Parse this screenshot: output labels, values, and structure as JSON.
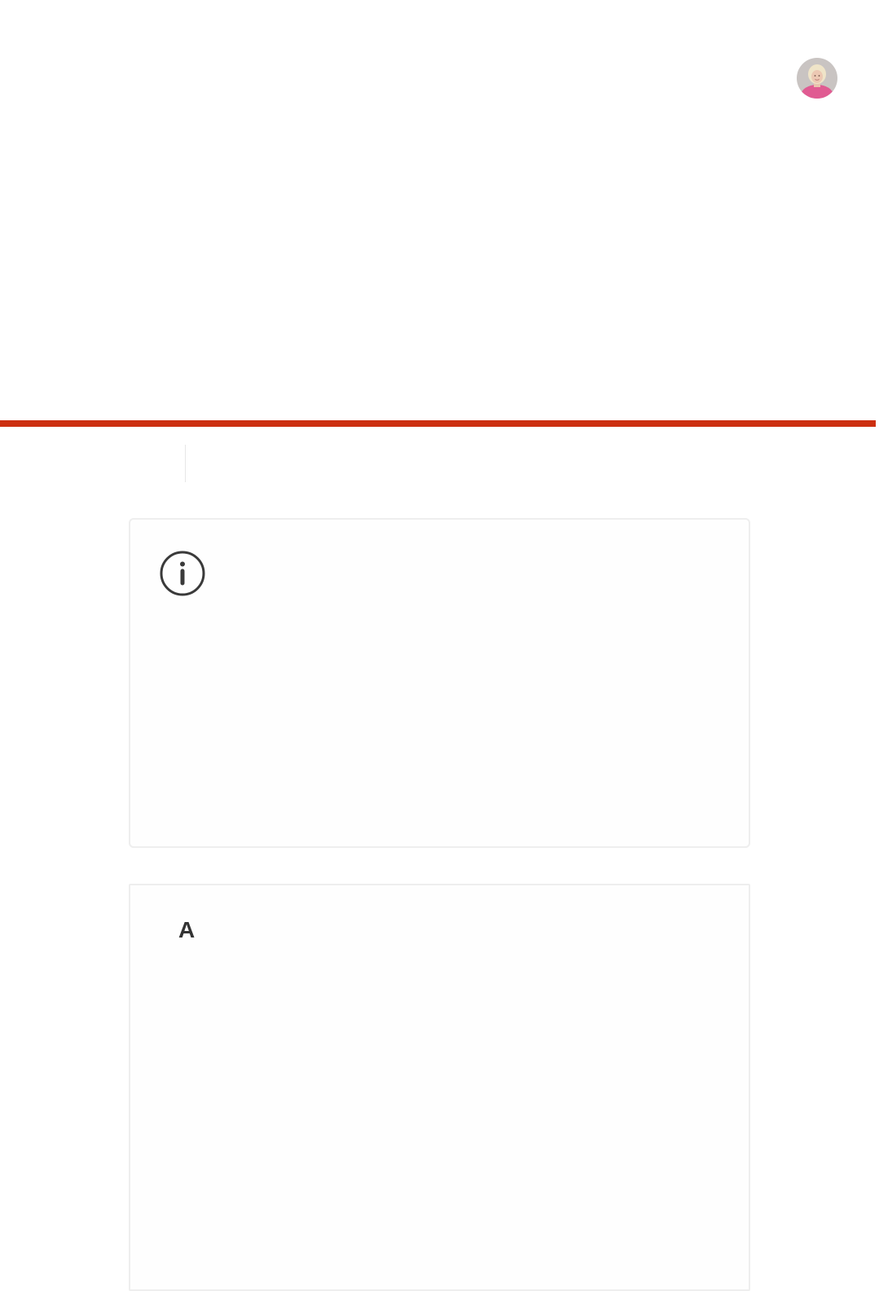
{
  "header": {
    "avatar": {
      "icon": "user-avatar-photo"
    }
  },
  "theme": {
    "accent_color": "#cc2f10",
    "border_color": "#eeeeee",
    "icon_color": "#3a3a3a"
  },
  "info_card": {
    "icon": "info-icon"
  },
  "letter_card": {
    "heading": "A"
  }
}
